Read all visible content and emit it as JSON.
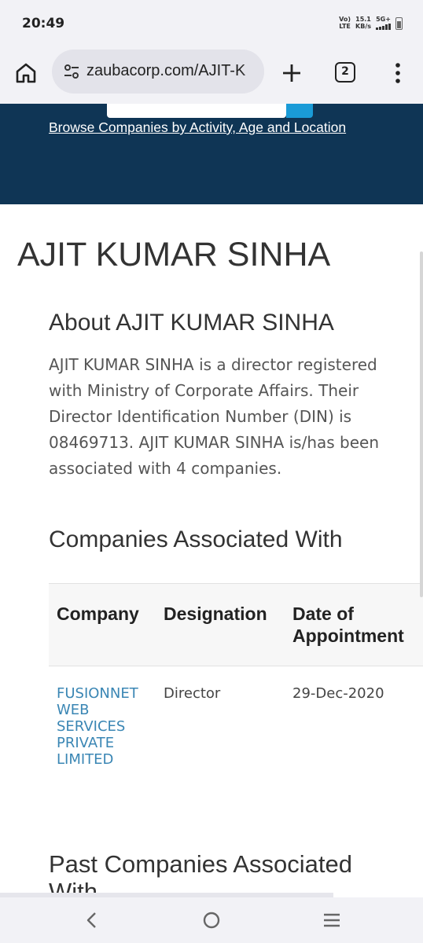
{
  "status_bar": {
    "time": "20:49",
    "volte_line1": "Vo)",
    "volte_line2": "LTE",
    "speed_value": "15.1",
    "speed_unit": "KB/s",
    "network": "5G+",
    "battery_icon": "battery-icon"
  },
  "browser": {
    "url": "zaubacorp.com/AJIT-K",
    "tab_count": "2",
    "icons": [
      "home-icon",
      "tune-icon",
      "plus-icon",
      "tabs-icon",
      "more-vert-icon"
    ]
  },
  "hero": {
    "browse_link": "Browse Companies by Activity, Age and Location"
  },
  "page": {
    "title": "AJIT KUMAR SINHA",
    "about_heading": "About AJIT KUMAR SINHA",
    "about_text": "AJIT KUMAR SINHA is a director registered with Ministry of Corporate Affairs. Their Director Identification Number (DIN) is 08469713. AJIT KUMAR SINHA is/has been associated with 4 companies.",
    "companies_heading": "Companies Associated With",
    "table": {
      "headers": [
        "Company",
        "Designation",
        "Date of Appointment"
      ],
      "rows": [
        {
          "company": "FUSIONNET WEB SERVICES PRIVATE LIMITED",
          "designation": "Director",
          "date": "29-Dec-2020"
        }
      ]
    },
    "past_heading": "Past Companies Associated With"
  },
  "colors": {
    "hero_bg": "#0f3555",
    "link": "#3a86b4",
    "search_accent": "#1a9bd7"
  }
}
